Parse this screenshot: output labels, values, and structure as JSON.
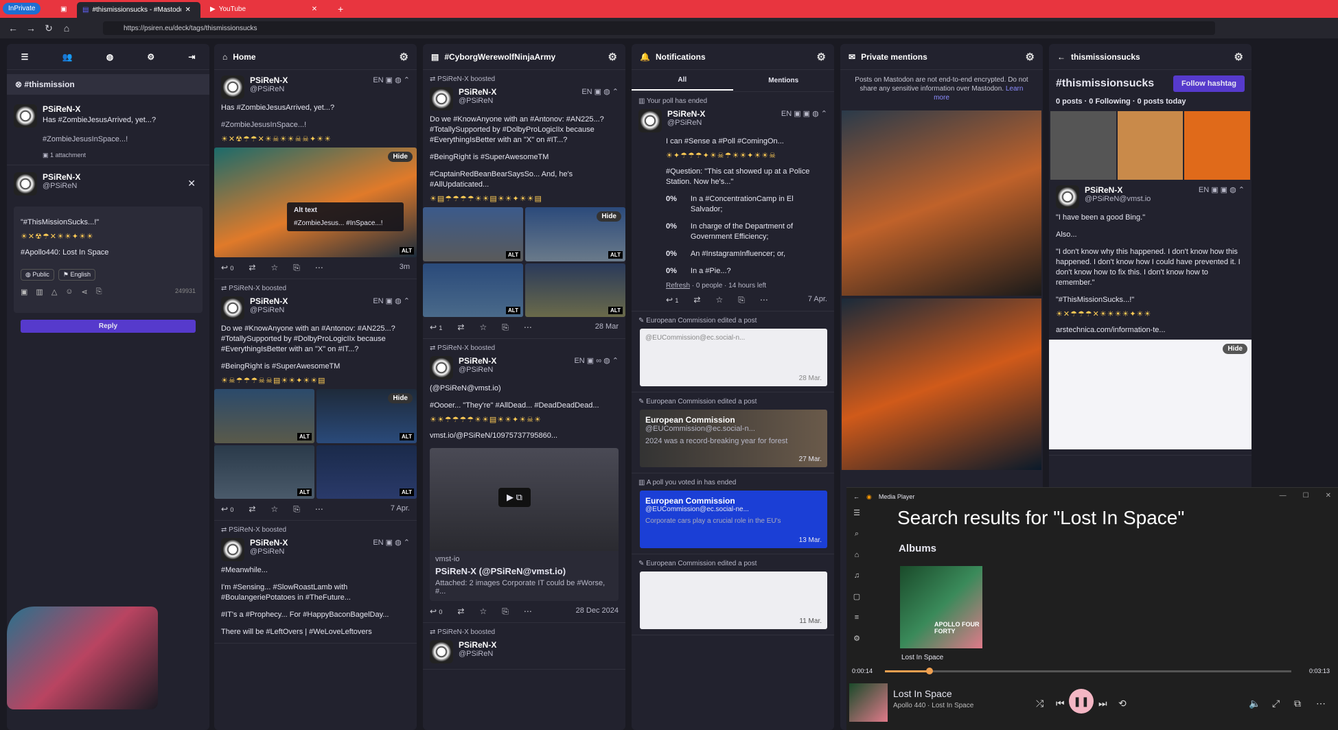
{
  "browser": {
    "inprivate": "InPrivate",
    "tab1": "#thismissionsucks - #Mastodon",
    "tab2": "YouTube",
    "url": "https://psiren.eu/deck/tags/thismissionsucks"
  },
  "sidebar": {
    "hashtag": "#thismission",
    "post": {
      "name": "PSiReN-X",
      "text": "Has #ZombieJesusArrived, yet...?",
      "sub": "#ZombieJesusInSpace...!",
      "attach": "1 attachment"
    },
    "reply": {
      "name": "PSiReN-X",
      "handle": "@PSiReN",
      "draft1": "\"#ThisMissionSucks...!\"",
      "draft2": "#Apollo440: Lost In Space",
      "vis": "Public",
      "lang": "English",
      "count": "249931",
      "btn": "Reply"
    }
  },
  "home": {
    "title": "Home",
    "p1": {
      "name": "PSiReN-X",
      "handle": "@PSiReN",
      "t1": "Has #ZombieJesusArrived, yet...?",
      "t2": "#ZombieJesusInSpace...!",
      "alt_label": "Alt text",
      "alt_text": "#ZombieJesus... #InSpace...!",
      "time": "3m",
      "n": "0",
      "hide": "Hide",
      "alt": "ALT"
    },
    "p2": {
      "boost": "PSiReN-X boosted",
      "name": "PSiReN-X",
      "handle": "@PSiReN",
      "t1": "Do we #KnowAnyone with an #Antonov: #AN225...? #TotallySupported by #DolbyProLogicIIx because #EverythingIsBetter with an \"X\" on #IT...?",
      "t2": "#BeingRight is #SuperAwesomeTM",
      "time": "7 Apr.",
      "n": "0",
      "hide": "Hide"
    },
    "p3": {
      "boost": "PSiReN-X boosted",
      "name": "PSiReN-X",
      "handle": "@PSiReN",
      "t1": "#Meanwhile...",
      "t2": "I'm #Sensing... #SlowRoastLamb with #BoulangeriePotatoes in #TheFuture...",
      "t3": "#IT's a #Prophecy... For #HappyBaconBagelDay...",
      "t4": "There will be #LeftOvers | #WeLoveLeftovers"
    }
  },
  "cyborg": {
    "title": "#CyborgWerewolfNinjaArmy",
    "p1": {
      "boost": "PSiReN-X boosted",
      "name": "PSiReN-X",
      "handle": "@PSiReN",
      "t1": "Do we #KnowAnyone with an #Antonov: #AN225...? #TotallySupported by #DolbyProLogicIIx because #EverythingIsBetter with an \"X\" on #IT...?",
      "t2": "#BeingRight is #SuperAwesomeTM",
      "t3": "#CaptainRedBeanBearSaysSo... And, he's #AllUpdaticated...",
      "time": "28 Mar",
      "n": "1",
      "hide": "Hide"
    },
    "p2": {
      "boost": "PSiReN-X boosted",
      "name": "PSiReN-X",
      "handle": "@PSiReN",
      "t1": "(@PSiReN@vmst.io)",
      "t2": "#Oooer... \"They're\" #AllDead... #DeadDeadDead...",
      "link": "vmst.io/@PSiReN/10975737795860...",
      "card_site": "vmst-io",
      "card_title": "PSiReN-X (@PSiReN@vmst.io)",
      "card_desc": "Attached: 2 images Corporate IT could be #Worse, #...",
      "time": "28 Dec 2024",
      "n": "0"
    },
    "p3": {
      "boost": "PSiReN-X boosted",
      "name": "PSiReN-X",
      "handle": "@PSiReN"
    }
  },
  "notif": {
    "title": "Notifications",
    "tab_all": "All",
    "tab_mentions": "Mentions",
    "poll_end": "Your poll has ended",
    "poll": {
      "name": "PSiReN-X",
      "handle": "@PSiReN",
      "t1": "I can #Sense a #Poll #ComingOn...",
      "q": "#Question: \"This cat showed up at a Police Station. Now he's...\"",
      "opts": [
        {
          "pct": "0%",
          "label": "In a #ConcentrationCamp in El Salvador;"
        },
        {
          "pct": "0%",
          "label": "In charge of the Department of Government Efficiency;"
        },
        {
          "pct": "0%",
          "label": "An #InstagramInfluencer; or,"
        },
        {
          "pct": "0%",
          "label": "In a #Pie...?"
        }
      ],
      "refresh": "Refresh",
      "info": "· 0 people · 14 hours left",
      "time": "7 Apr.",
      "n": "1"
    },
    "edit1": "European Commission edited a post",
    "ec_handle": "@EUCommission@ec.social-n...",
    "time1": "28 Mar.",
    "edit2": "European Commission edited a post",
    "ec_name": "European Commission",
    "ec_text2": "2024 was a record-breaking year for forest",
    "time2": "27 Mar.",
    "poll2": "A poll you voted in has ended",
    "ec_handle3": "@EUCommission@ec.social-ne...",
    "ec_text3": "Corporate cars play a crucial role in the EU's",
    "time3": "13 Mar.",
    "edit3": "European Commission edited a post",
    "time4": "11 Mar."
  },
  "private": {
    "title": "Private mentions",
    "warn": "Posts on Mastodon are not end-to-end encrypted. Do not share any sensitive information over Mastodon.",
    "learn": "Learn more"
  },
  "tag": {
    "title": "thismissionsucks",
    "name": "#thismissionsucks",
    "follow": "Follow hashtag",
    "stats": "0 posts · 0 Following · 0 posts today",
    "post": {
      "name": "PSiReN-X",
      "handle": "@PSiReN@vmst.io",
      "t1": "\"I have been a good Bing.\"",
      "t2": "Also...",
      "t3": "\"I don't know why this happened. I don't know how this happened. I don't know how I could have prevented it. I don't know how to fix this. I don't know how to remember.\"",
      "t4": "\"#ThisMissionSucks...!\"",
      "link": "arstechnica.com/information-te...",
      "hide": "Hide"
    }
  },
  "media": {
    "app": "Media Player",
    "heading": "Search results for \"Lost In Space\"",
    "albums": "Albums",
    "album": "Lost In Space",
    "cover": "APOLLO FOUR FORTY",
    "elapsed": "0:00:14",
    "total": "0:03:13",
    "progress": 0.11,
    "track": "Lost In Space",
    "artist": "Apollo 440 · Lost In Space"
  }
}
